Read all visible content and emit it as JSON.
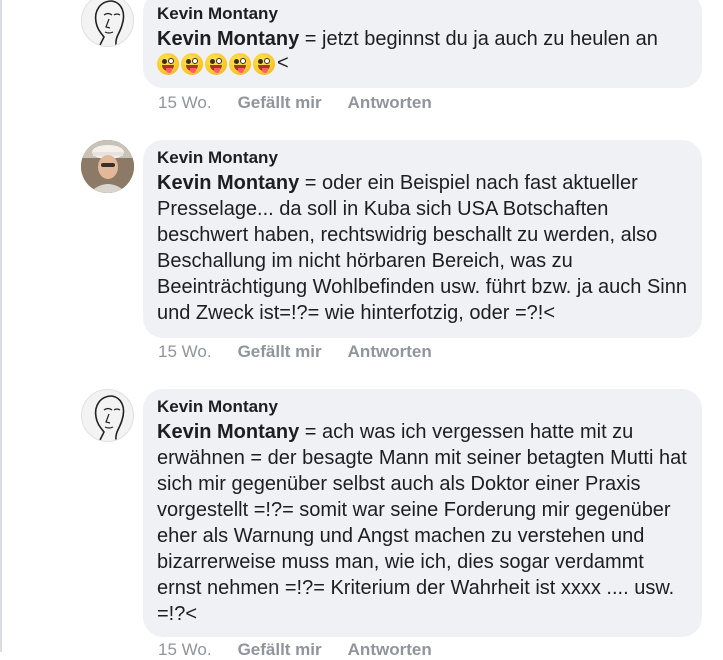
{
  "comments": [
    {
      "author": "Kevin Montany",
      "mention": "Kevin Montany",
      "text": " = jetzt beginnst du ja auch zu heulen an",
      "trail": "<",
      "emoji_count": 5,
      "time": "15 Wo.",
      "like_label": "Gefällt mir",
      "reply_label": "Antworten",
      "avatar": "sketch-face-icon"
    },
    {
      "author": "Kevin Montany",
      "mention": "Kevin Montany",
      "text": " = oder ein Beispiel nach fast aktueller Presselage... da soll in Kuba sich USA Botschaften beschwert haben, rechtswidrig beschallt zu werden, also Beschallung im nicht hörbaren Bereich, was zu Beeinträchtigung Wohlbefinden usw. führt bzw. ja auch Sinn und Zweck ist=!?= wie hinterfotzig, oder =?!<",
      "time": "15 Wo.",
      "like_label": "Gefällt mir",
      "reply_label": "Antworten",
      "avatar": "profile-photo"
    },
    {
      "author": "Kevin Montany",
      "mention": "Kevin Montany",
      "text": " = ach was ich vergessen hatte mit zu erwähnen = der besagte Mann mit seiner betagten Mutti hat sich mir gegenüber selbst auch als Doktor einer Praxis vorgestellt =!?= somit war seine Forderung mir gegenüber eher als  Warnung und  Angst machen zu verstehen und bizarrerweise muss man, wie ich, dies sogar verdammt ernst nehmen =!?= Kriterium der Wahrheit ist xxxx .... usw. =!?<",
      "time": "15 Wo.",
      "like_label": "Gefällt mir",
      "reply_label": "Antworten",
      "avatar": "sketch-face-icon"
    }
  ]
}
